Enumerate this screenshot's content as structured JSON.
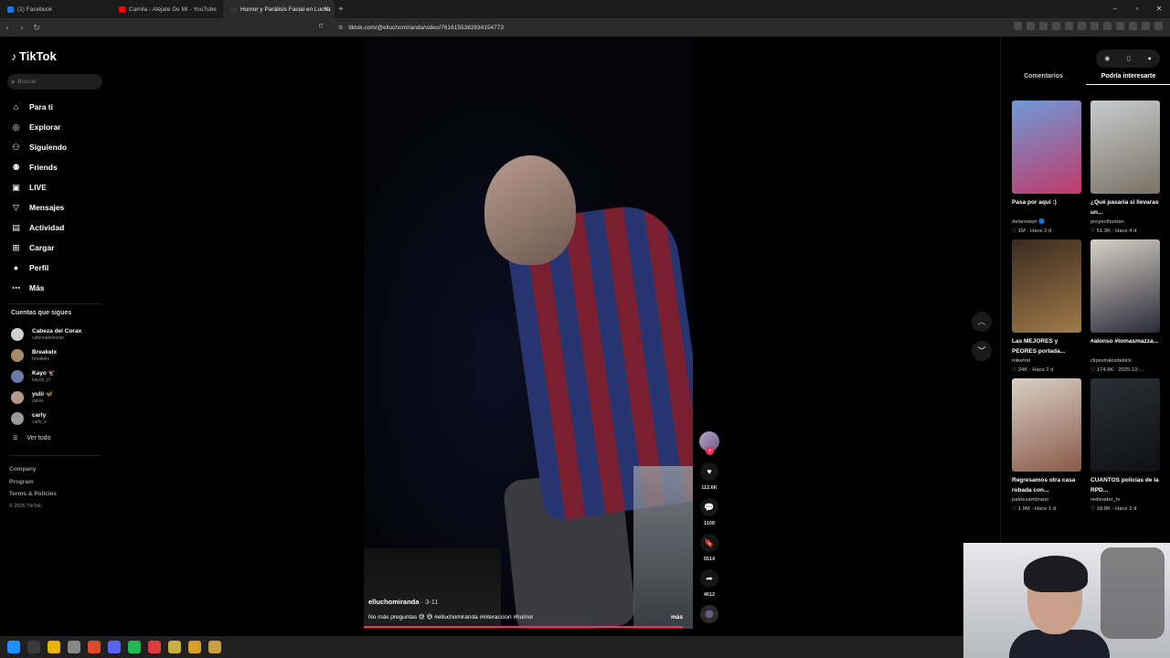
{
  "browser": {
    "tabs": [
      {
        "title": "(1) Facebook",
        "color": "#1877f2"
      },
      {
        "title": "Camila - Aléjate De Mí - YouTube",
        "color": "#ff0000"
      },
      {
        "title": "Humor y Parálisis Facial en Lucha",
        "color": "#111111"
      }
    ],
    "url": "tiktok.com/@elluchomiranda/video/7616155382834154773"
  },
  "sidebar": {
    "logo": "TikTok",
    "search_placeholder": "Buscar",
    "nav": [
      {
        "label": "Para ti",
        "icon": "home-icon",
        "glyph": "⌂"
      },
      {
        "label": "Explorar",
        "icon": "compass-icon",
        "glyph": "◎"
      },
      {
        "label": "Siguiendo",
        "icon": "person-icon",
        "glyph": "⚇"
      },
      {
        "label": "Friends",
        "icon": "friends-icon",
        "glyph": "⚉"
      },
      {
        "label": "LIVE",
        "icon": "live-icon",
        "glyph": "▣"
      },
      {
        "label": "Mensajes",
        "icon": "messages-icon",
        "glyph": "▽"
      },
      {
        "label": "Actividad",
        "icon": "activity-icon",
        "glyph": "▤"
      },
      {
        "label": "Cargar",
        "icon": "upload-icon",
        "glyph": "⊞"
      },
      {
        "label": "Perfil",
        "icon": "profile-icon",
        "glyph": "●"
      },
      {
        "label": "Más",
        "icon": "more-icon",
        "glyph": "⋯"
      }
    ],
    "following_title": "Cuentas que sigues",
    "following": [
      {
        "name": "Cabeza del Corax",
        "handle": "cabezadelcorax",
        "color": "#cfcfcf"
      },
      {
        "name": "Breakelx",
        "handle": "breakelx",
        "color": "#a88a6a"
      },
      {
        "name": "Kayo 🦅",
        "handle": "kayoo_cl",
        "color": "#6a7aa8"
      },
      {
        "name": "yulii 🦋",
        "handle": "yulixv",
        "color": "#b59a8a"
      },
      {
        "name": "carly",
        "handle": "carly_v",
        "color": "#9a9a9a"
      }
    ],
    "see_all": "Ver todo",
    "footer": [
      "Company",
      "Program",
      "Terms & Policies"
    ],
    "copyright": "© 2026 TikTok"
  },
  "video": {
    "author": "elluchomiranda",
    "date": "· 3-11",
    "description": "No más preguntas 😅 😅 #elluchomiranda #interaccion #humor",
    "more": "más",
    "progress": 0.97
  },
  "actions": {
    "likes": "112.6K",
    "comments": "1109",
    "saves": "5514",
    "shares": "4612"
  },
  "right_panel": {
    "tabs": [
      "Comentarios",
      "Podría interesarte"
    ],
    "active_tab": 1,
    "cards": [
      {
        "title": "Pasa por aquí :)",
        "author": "delarosepr 🔵",
        "stats": "♡ 1M · Hace 2 d",
        "c1": "#6e9ad8",
        "c2": "#c03a6a"
      },
      {
        "title": "¿Qué pasaría si llevaras un...",
        "author": "proyecthuman",
        "stats": "♡ 51.3K · Hace 4 d",
        "c1": "#c8ccd0",
        "c2": "#7a7262"
      },
      {
        "title": "Las MEJORES y PEORES portada...",
        "author": "mikelrid",
        "stats": "♡ 34K · Hace 2 d",
        "c1": "#3a2a1e",
        "c2": "#a07a4a"
      },
      {
        "title": "#alonso #tomasmazza...",
        "author": "clipsviralesdekick",
        "stats": "♡ 174.9K · 2025-12-...",
        "c1": "#d8d2c6",
        "c2": "#2a2a3a"
      },
      {
        "title": "Regresamos otra casa robada con...",
        "author": "patoezambrano",
        "stats": "♡ 1.9M · Hace 1 d",
        "c1": "#d8cfc4",
        "c2": "#8a5a4a"
      },
      {
        "title": "CUANTOS policias de la RPD...",
        "author": "redleader_tv",
        "stats": "♡ 18.8K · Hace 2 d",
        "c1": "#2a3038",
        "c2": "#0e1014"
      }
    ]
  },
  "taskbar_colors": [
    "#1e90ff",
    "#3a3a3a",
    "#e8b400",
    "#888888",
    "#e0482c",
    "#5865f2",
    "#1db954",
    "#e03a3a",
    "#c8b040",
    "#d8a020",
    "#c8a040"
  ]
}
